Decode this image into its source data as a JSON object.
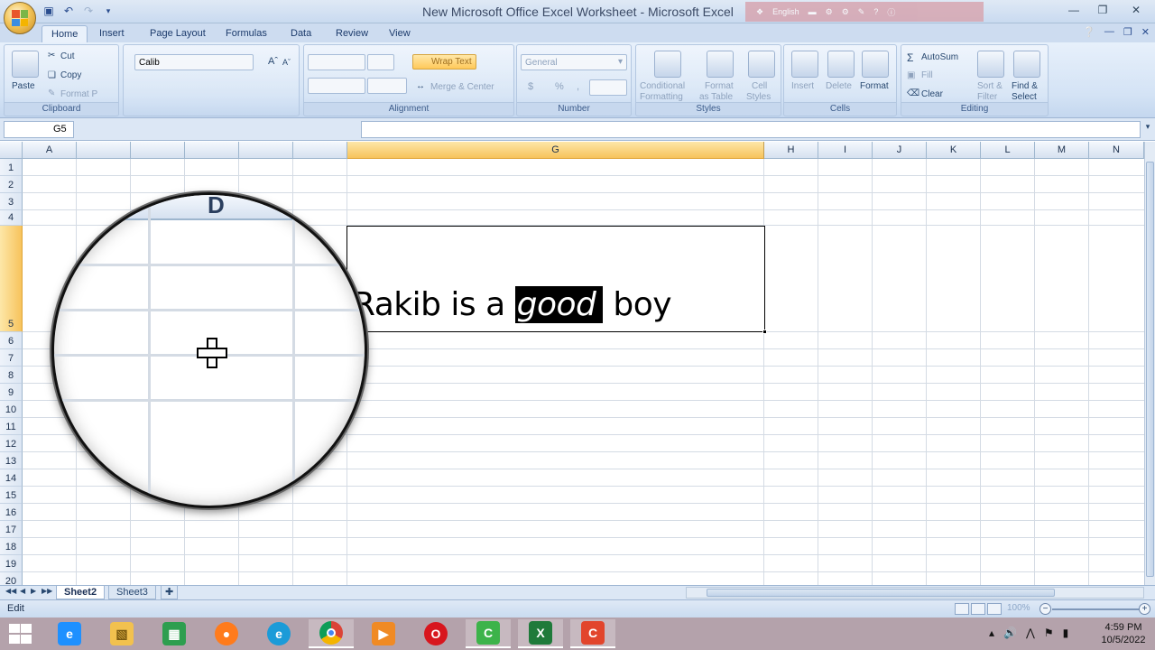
{
  "window": {
    "title": "New Microsoft Office Excel Worksheet - Microsoft Excel",
    "language": "English"
  },
  "tabs": [
    "Home",
    "Insert",
    "Page Layout",
    "Formulas",
    "Data",
    "Review",
    "View"
  ],
  "ribbon": {
    "clipboard": {
      "label": "Clipboard",
      "paste": "Paste",
      "cut": "Cut",
      "copy": "Copy",
      "format_painter": "Format P"
    },
    "font": {
      "name_partial": "Calib"
    },
    "alignment": {
      "label": "Alignment",
      "wrap_text": "Wrap Text",
      "merge_center": "Merge & Center"
    },
    "number": {
      "label": "Number",
      "format": "General",
      "currency": "$",
      "percent": "%",
      "comma": ","
    },
    "styles": {
      "label": "Styles",
      "conditional": [
        "Conditional",
        "Formatting"
      ],
      "format_table": [
        "Format",
        "as Table"
      ],
      "cell_styles": [
        "Cell",
        "Styles"
      ]
    },
    "cells": {
      "label": "Cells",
      "insert": "Insert",
      "delete": "Delete",
      "format": "Format"
    },
    "editing": {
      "label": "Editing",
      "autosum": "AutoSum",
      "fill": "Fill",
      "clear": "Clear",
      "sort": [
        "Sort &",
        "Filter"
      ],
      "find": [
        "Find &",
        "Select"
      ]
    }
  },
  "formula_bar": {
    "name_box": "G5",
    "value": ""
  },
  "columns": [
    "A",
    "G",
    "H",
    "I",
    "J",
    "K",
    "L",
    "M",
    "N"
  ],
  "rows": [
    "1",
    "2",
    "3",
    "4",
    "5",
    "6",
    "7",
    "8",
    "9",
    "10",
    "11",
    "12",
    "13",
    "14",
    "15",
    "16",
    "17",
    "18",
    "19",
    "20"
  ],
  "selected": {
    "column": "G",
    "row": "5"
  },
  "cell": {
    "text_before": "Rakib is a ",
    "text_highlight": "good",
    "text_after": " boy"
  },
  "magnifier": {
    "column_letter": "D"
  },
  "sheets": [
    "Sheet2",
    "Sheet3"
  ],
  "active_sheet": "Sheet2",
  "status": {
    "mode": "Edit",
    "zoom": "100%"
  },
  "taskbar": {
    "apps": [
      "internet-explorer",
      "file-explorer",
      "microsoft-store",
      "firefox",
      "edge",
      "chrome",
      "media-player",
      "opera",
      "camtasia-recorder",
      "excel",
      "camtasia"
    ],
    "time": "4:59 PM",
    "date": "10/5/2022"
  }
}
